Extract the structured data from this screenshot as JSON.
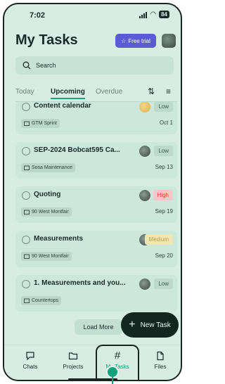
{
  "status_bar": {
    "time": "7:02",
    "battery": "84"
  },
  "header": {
    "title": "My Tasks",
    "trial_label": "Free trial"
  },
  "search": {
    "placeholder": "Search"
  },
  "tabs": [
    {
      "label": "Today",
      "active": false
    },
    {
      "label": "Upcoming",
      "active": true
    },
    {
      "label": "Overdue",
      "active": false
    }
  ],
  "tasks": [
    {
      "title": "Content calendar",
      "project": "GTM Sprint",
      "date": "Oct 1",
      "priority": "Low",
      "priority_level": "low",
      "assignee_color": "yellow"
    },
    {
      "title": "SEP-2024 Bobcat595 Ca...",
      "project": "Sosa Maintenance",
      "date": "Sep 13",
      "priority": "Low",
      "priority_level": "low",
      "assignee_color": "gray"
    },
    {
      "title": "Quoting",
      "project": "90 West Montfair",
      "date": "Sep 19",
      "priority": "High",
      "priority_level": "high",
      "assignee_color": "gray"
    },
    {
      "title": "Measurements",
      "project": "90 West Montfair",
      "date": "Sep 20",
      "priority": "Medium",
      "priority_level": "medium",
      "assignee_color": "gray"
    },
    {
      "title": "1. Measurements and you...",
      "project": "Countertops",
      "date": "",
      "priority": "Low",
      "priority_level": "low",
      "assignee_color": "gray"
    }
  ],
  "actions": {
    "load_more": "Load More",
    "new_task": "New Task"
  },
  "bottom_nav": [
    {
      "label": "Chats",
      "icon": "chat-icon"
    },
    {
      "label": "Projects",
      "icon": "folder-icon"
    },
    {
      "label": "My Tasks",
      "icon": "hash-icon",
      "active": true
    },
    {
      "label": "Files",
      "icon": "file-icon"
    }
  ],
  "colors": {
    "accent": "#17a57a",
    "trial": "#5b5bd6",
    "background": "#d7ede4",
    "high": "#d43d3d",
    "medium": "#b8a24a"
  }
}
